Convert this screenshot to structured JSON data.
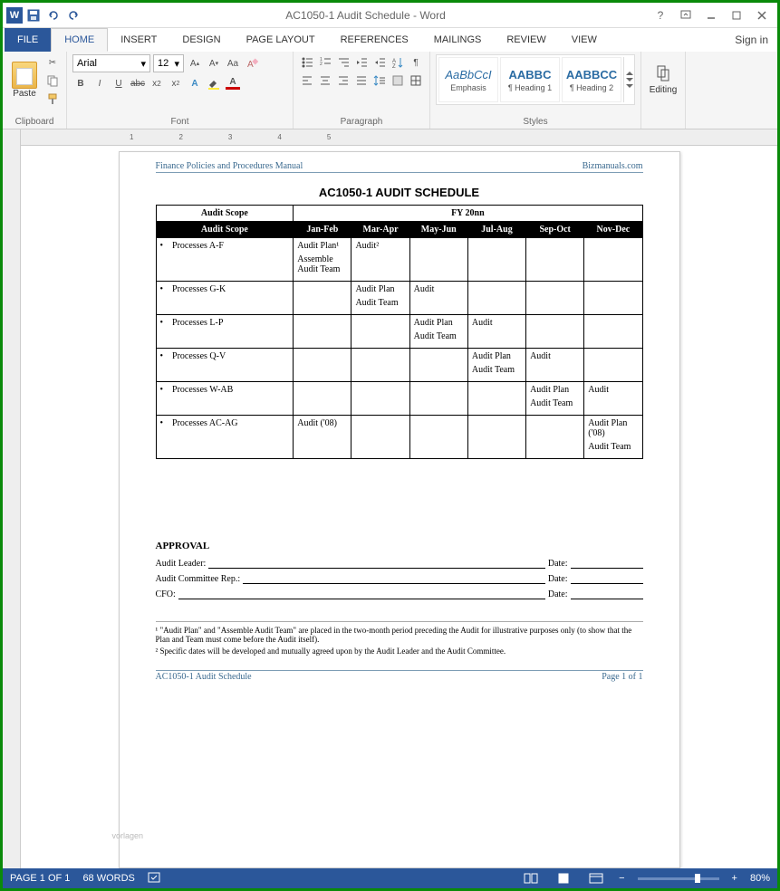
{
  "titlebar": {
    "title": "AC1050-1 Audit Schedule - Word"
  },
  "tabs": {
    "file": "FILE",
    "home": "HOME",
    "insert": "INSERT",
    "design": "DESIGN",
    "page_layout": "PAGE LAYOUT",
    "references": "REFERENCES",
    "mailings": "MAILINGS",
    "review": "REVIEW",
    "view": "VIEW",
    "signin": "Sign in"
  },
  "ribbon": {
    "clipboard": {
      "label": "Clipboard",
      "paste": "Paste"
    },
    "font": {
      "label": "Font",
      "name": "Arial",
      "size": "12"
    },
    "paragraph": {
      "label": "Paragraph"
    },
    "styles": {
      "label": "Styles",
      "items": [
        {
          "preview": "AaBbCcI",
          "name": "Emphasis"
        },
        {
          "preview": "AABBC",
          "name": "¶ Heading 1"
        },
        {
          "preview": "AABBCC",
          "name": "¶ Heading 2"
        }
      ]
    },
    "editing": {
      "label": "Editing"
    }
  },
  "document": {
    "header_left": "Finance Policies and Procedures Manual",
    "header_right": "Bizmanuals.com",
    "title": "AC1050-1 AUDIT SCHEDULE",
    "fy_label": "FY 20nn",
    "columns": [
      "Audit Scope",
      "Jan-Feb",
      "Mar-Apr",
      "May-Jun",
      "Jul-Aug",
      "Sep-Oct",
      "Nov-Dec"
    ],
    "rows": [
      {
        "scope": "Processes A-F",
        "cells": [
          "Audit Plan¹\nAssemble Audit Team",
          "Audit²",
          "",
          "",
          "",
          ""
        ]
      },
      {
        "scope": "Processes G-K",
        "cells": [
          "",
          "Audit Plan\nAudit Team",
          "Audit",
          "",
          "",
          ""
        ]
      },
      {
        "scope": "Processes L-P",
        "cells": [
          "",
          "",
          "Audit Plan\nAudit Team",
          "Audit",
          "",
          ""
        ]
      },
      {
        "scope": "Processes Q-V",
        "cells": [
          "",
          "",
          "",
          "Audit Plan\nAudit Team",
          "Audit",
          ""
        ]
      },
      {
        "scope": "Processes W-AB",
        "cells": [
          "",
          "",
          "",
          "",
          "Audit Plan\nAudit Team",
          "Audit"
        ]
      },
      {
        "scope": "Processes AC-AG",
        "cells": [
          "Audit ('08)",
          "",
          "",
          "",
          "",
          "Audit Plan ('08)\nAudit Team"
        ]
      }
    ],
    "approval": {
      "heading": "APPROVAL",
      "rows": [
        {
          "label": "Audit Leader:",
          "date": "Date:"
        },
        {
          "label": "Audit Committee Rep.:",
          "date": "Date:"
        },
        {
          "label": "CFO:",
          "date": "Date:"
        }
      ]
    },
    "footnotes": [
      "¹ \"Audit Plan\" and \"Assemble Audit Team\" are placed in the two-month period preceding the Audit for illustrative purposes only (to show that the Plan and Team must come before the Audit itself).",
      "² Specific dates will be developed and mutually agreed upon by the Audit Leader and the Audit Committee."
    ],
    "footer_left": "AC1050-1 Audit Schedule",
    "footer_right": "Page 1 of 1",
    "watermark": "vorlagen"
  },
  "statusbar": {
    "page": "PAGE 1 OF 1",
    "words": "68 WORDS",
    "zoom": "80%"
  },
  "ruler_marks": [
    "1",
    "2",
    "3",
    "4",
    "5"
  ]
}
